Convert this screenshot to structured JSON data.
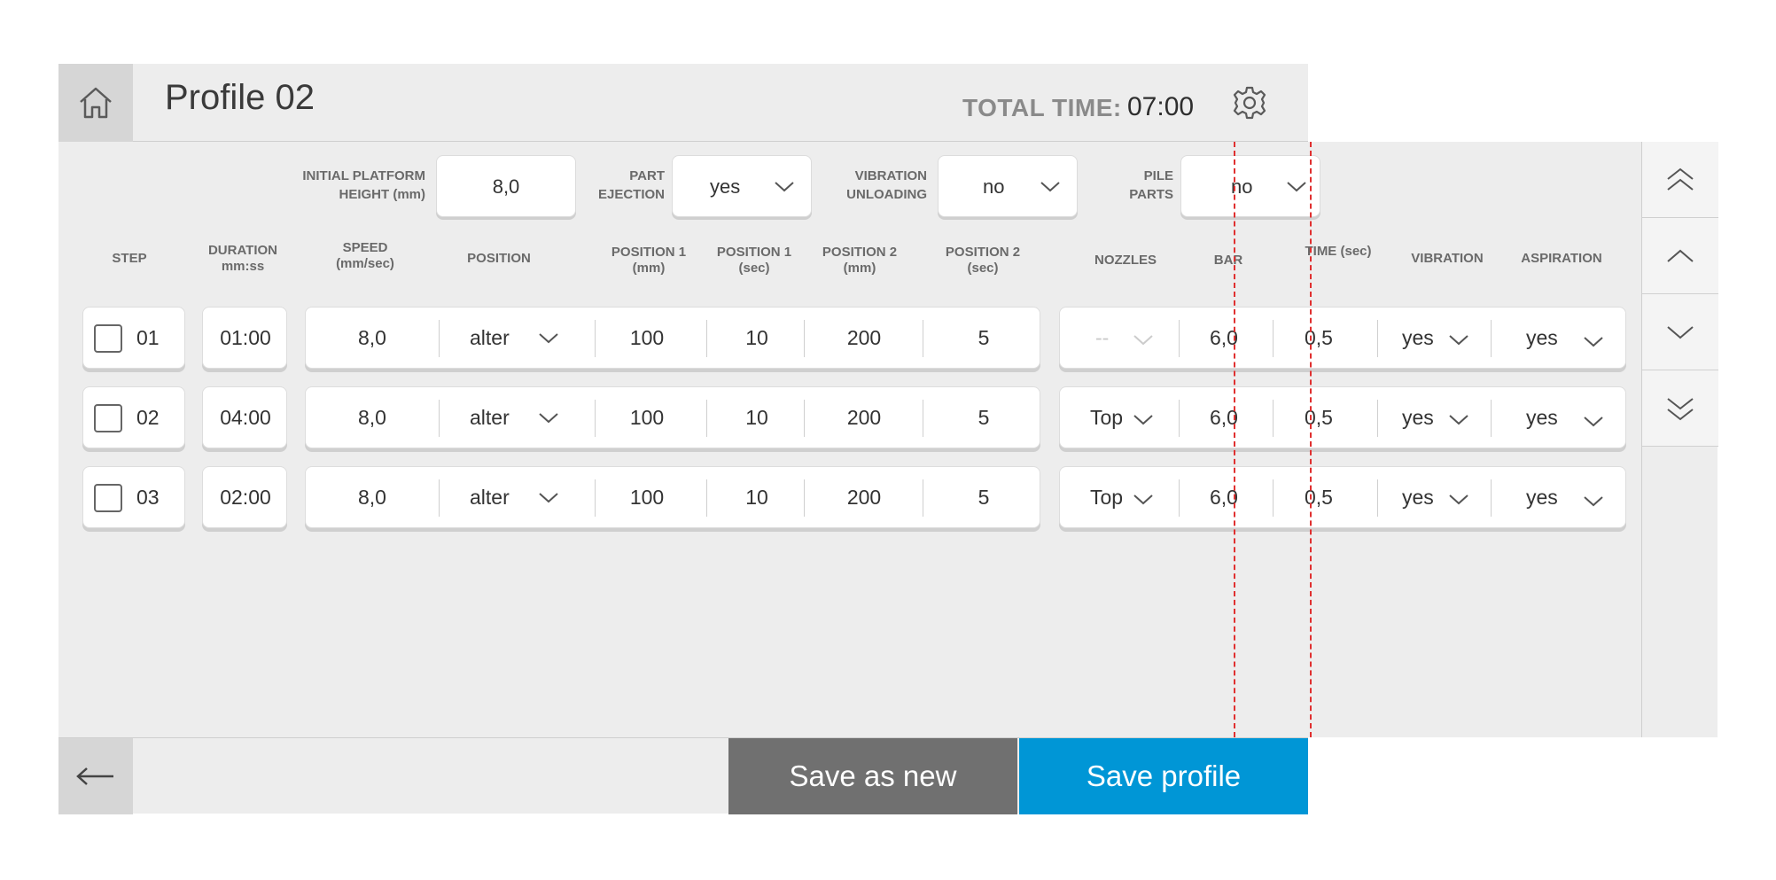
{
  "header": {
    "title": "Profile 02",
    "total_time_label": "TOTAL TIME:",
    "total_time_value": "07:00"
  },
  "params": {
    "initial_platform_label": "INITIAL PLATFORM HEIGHT (mm)",
    "initial_platform_value": "8,0",
    "part_ejection_label": "PART EJECTION",
    "part_ejection_value": "yes",
    "vibration_unloading_label": "VIBRATION UNLOADING",
    "vibration_unloading_value": "no",
    "pile_parts_label": "PILE PARTS",
    "pile_parts_value": "no"
  },
  "columns": {
    "step": "STEP",
    "duration": "DURATION mm:ss",
    "speed": "SPEED (mm/sec)",
    "position": "POSITION",
    "position1_mm": "POSITION 1 (mm)",
    "position1_sec": "POSITION 1 (sec)",
    "position2_mm": "POSITION 2 (mm)",
    "position2_sec": "POSITION 2 (sec)",
    "nozzles": "NOZZLES",
    "bar": "BAR",
    "time": "TIME (sec)",
    "vibration": "VIBRATION",
    "aspiration": "ASPIRATION"
  },
  "rows": [
    {
      "step": "01",
      "duration": "01:00",
      "speed": "8,0",
      "position": "alter",
      "p1mm": "100",
      "p1sec": "10",
      "p2mm": "200",
      "p2sec": "5",
      "nozzles": "--",
      "bar": "6,0",
      "time": "0,5",
      "vibration": "yes",
      "aspiration": "yes"
    },
    {
      "step": "02",
      "duration": "04:00",
      "speed": "8,0",
      "position": "alter",
      "p1mm": "100",
      "p1sec": "10",
      "p2mm": "200",
      "p2sec": "5",
      "nozzles": "Top",
      "bar": "6,0",
      "time": "0,5",
      "vibration": "yes",
      "aspiration": "yes"
    },
    {
      "step": "03",
      "duration": "02:00",
      "speed": "8,0",
      "position": "alter",
      "p1mm": "100",
      "p1sec": "10",
      "p2mm": "200",
      "p2sec": "5",
      "nozzles": "Top",
      "bar": "6,0",
      "time": "0,5",
      "vibration": "yes",
      "aspiration": "yes"
    }
  ],
  "footer": {
    "save_as_new": "Save as new",
    "save_profile": "Save profile"
  },
  "colors": {
    "accent": "#0096d6",
    "secondary_button": "#707070",
    "panel": "#ededed",
    "guide_line": "#e03030"
  }
}
